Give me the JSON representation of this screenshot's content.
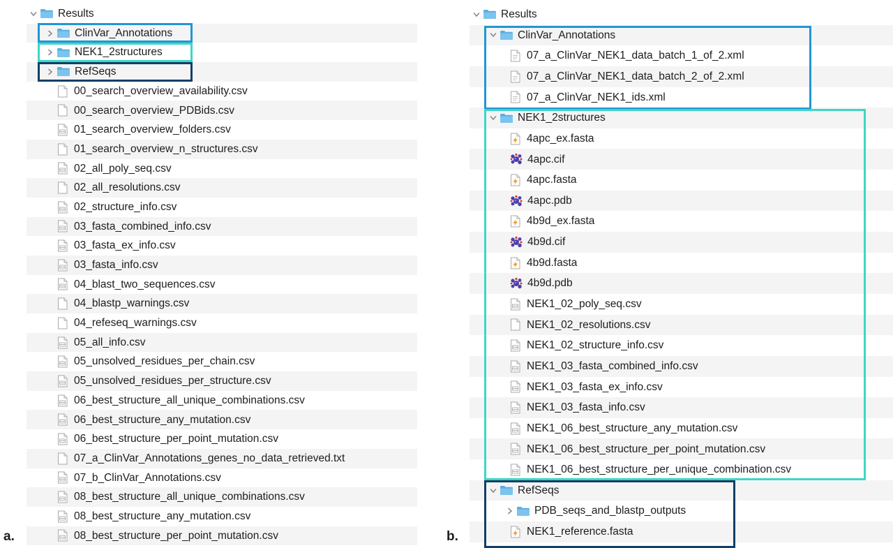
{
  "colors": {
    "clinvar_box": "#2196d3",
    "nek1_box": "#3ed6c6",
    "refseqs_box": "#123f66",
    "folder_blue": "#5aaee0",
    "stripe": "#f4f4f5"
  },
  "panel_a": {
    "letter": "a.",
    "root": "Results",
    "folders": [
      "ClinVar_Annotations",
      "NEK1_2structures",
      "RefSeqs"
    ],
    "files": [
      "00_search_overview_availability.csv",
      "00_search_overview_PDBids.csv",
      "01_search_overview_folders.csv",
      "01_search_overview_n_structures.csv",
      "02_all_poly_seq.csv",
      "02_all_resolutions.csv",
      "02_structure_info.csv",
      "03_fasta_combined_info.csv",
      "03_fasta_ex_info.csv",
      "03_fasta_info.csv",
      "04_blast_two_sequences.csv",
      "04_blastp_warnings.csv",
      "04_refeseq_warnings.csv",
      "05_all_info.csv",
      "05_unsolved_residues_per_chain.csv",
      "05_unsolved_residues_per_structure.csv",
      "06_best_structure_all_unique_combinations.csv",
      "06_best_structure_any_mutation.csv",
      "06_best_structure_per_point_mutation.csv",
      "07_a_ClinVar_Annotations_genes_no_data_retrieved.txt",
      "07_b_ClinVar_Annotations.csv",
      "08_best_structure_all_unique_combinations.csv",
      "08_best_structure_any_mutation.csv",
      "08_best_structure_per_point_mutation.csv"
    ],
    "file_icons": [
      "blank",
      "blank",
      "table",
      "blank",
      "table",
      "blank",
      "table",
      "table",
      "table",
      "table",
      "table",
      "blank",
      "blank",
      "table",
      "table",
      "table",
      "table",
      "table",
      "table",
      "blank",
      "table",
      "table",
      "table",
      "table"
    ]
  },
  "panel_b": {
    "letter": "b.",
    "root": "Results",
    "clinvar": {
      "name": "ClinVar_Annotations",
      "files": [
        "07_a_ClinVar_NEK1_data_batch_1_of_2.xml",
        "07_a_ClinVar_NEK1_data_batch_2_of_2.xml",
        "07_a_ClinVar_NEK1_ids.xml"
      ]
    },
    "nek1": {
      "name": "NEK1_2structures",
      "files": [
        "4apc_ex.fasta",
        "4apc.cif",
        "4apc.fasta",
        "4apc.pdb",
        "4b9d_ex.fasta",
        "4b9d.cif",
        "4b9d.fasta",
        "4b9d.pdb",
        "NEK1_02_poly_seq.csv",
        "NEK1_02_resolutions.csv",
        "NEK1_02_structure_info.csv",
        "NEK1_03_fasta_combined_info.csv",
        "NEK1_03_fasta_ex_info.csv",
        "NEK1_03_fasta_info.csv",
        "NEK1_06_best_structure_any_mutation.csv",
        "NEK1_06_best_structure_per_point_mutation.csv",
        "NEK1_06_best_structure_per_unique_combination.csv"
      ],
      "file_icons": [
        "fasta",
        "molecule",
        "fasta",
        "molecule",
        "fasta",
        "molecule",
        "fasta",
        "molecule",
        "table",
        "blank",
        "table",
        "table",
        "table",
        "table",
        "table",
        "table",
        "table"
      ]
    },
    "refseqs": {
      "name": "RefSeqs",
      "subfolder": "PDB_seqs_and_blastp_outputs",
      "files": [
        "NEK1_reference.fasta"
      ]
    }
  }
}
